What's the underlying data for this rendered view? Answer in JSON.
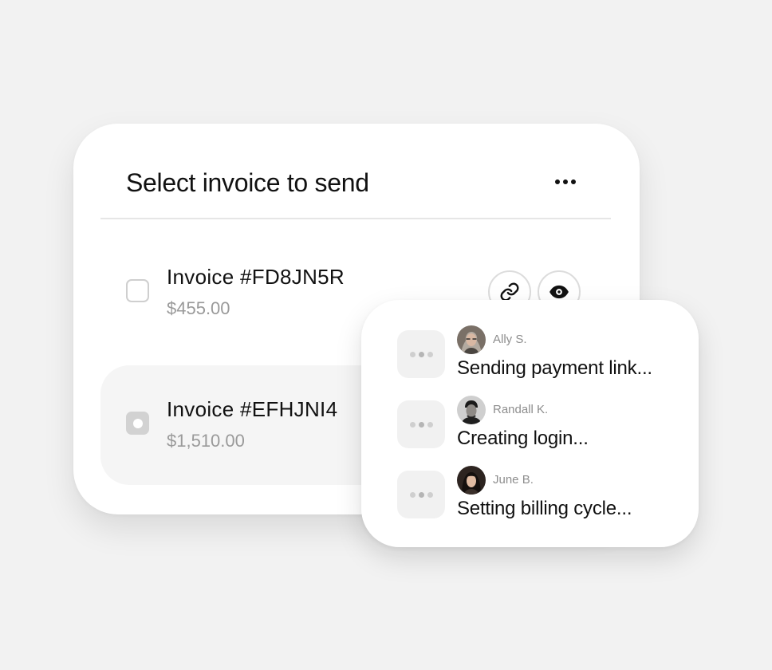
{
  "card": {
    "title": "Select invoice to send",
    "invoices": [
      {
        "name": "Invoice #FD8JN5R",
        "amount": "$455.00",
        "selected": false
      },
      {
        "name": "Invoice #EFHJNI4",
        "amount": "$1,510.00",
        "selected": true
      }
    ]
  },
  "popup": {
    "tasks": [
      {
        "person": "Ally S.",
        "status": "Sending payment link..."
      },
      {
        "person": "Randall K.",
        "status": "Creating login..."
      },
      {
        "person": "June B.",
        "status": "Setting billing cycle..."
      }
    ]
  },
  "icons": {
    "more": "more-horizontal-icon",
    "link": "link-icon",
    "eye": "eye-icon",
    "typing": "typing-indicator-icon"
  },
  "colors": {
    "background": "#f2f2f2",
    "card": "#ffffff",
    "text": "#111111",
    "muted": "#9a9a9a",
    "selected_row": "#f5f5f5"
  }
}
